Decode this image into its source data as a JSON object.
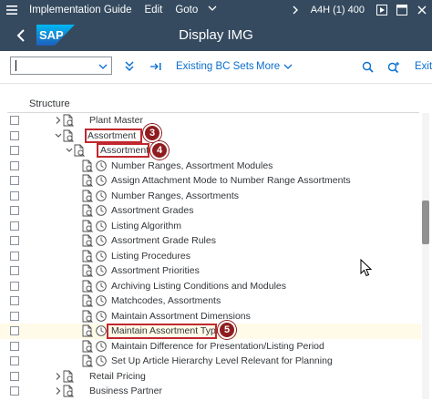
{
  "titlebar": {
    "menu": [
      "Implementation Guide",
      "Edit",
      "Goto"
    ],
    "system": "A4H (1) 400",
    "icons": [
      "hamburger-menu-icon",
      "chevron-down-icon",
      "chevron-right-icon",
      "play-icon",
      "window-icon",
      "close-icon"
    ]
  },
  "header": {
    "title": "Display IMG",
    "logo_text": "SAP",
    "brand_color": "#354a5f",
    "logo_color": "#1c8fd8"
  },
  "toolbar": {
    "command_value": "",
    "existing_bc_sets": "Existing BC Sets",
    "more": "More",
    "exit": "Exit",
    "icons": [
      "collapse-all-icon",
      "expand-subtree-icon",
      "find-icon",
      "find-next-icon"
    ]
  },
  "structure": {
    "header": "Structure",
    "rows": [
      {
        "label": "Plant Master",
        "expander": "closed"
      },
      {
        "label": "Assortment",
        "expander": "open"
      },
      {
        "label": "Assortment",
        "expander": "open"
      },
      {
        "label": "Number Ranges, Assortment Modules"
      },
      {
        "label": "Assign Attachment Mode to Number Range Assortments"
      },
      {
        "label": "Number Ranges, Assortments"
      },
      {
        "label": "Assortment Grades"
      },
      {
        "label": "Listing Algorithm"
      },
      {
        "label": "Assortment Grade Rules"
      },
      {
        "label": "Listing Procedures"
      },
      {
        "label": "Assortment Priorities"
      },
      {
        "label": "Archiving Listing Conditions and Modules"
      },
      {
        "label": "Matchcodes, Assortments"
      },
      {
        "label": "Maintain Assortment Dimensions"
      },
      {
        "label": "Maintain Assortment Types",
        "selected": true
      },
      {
        "label": "Maintain Difference for Presentation/Listing Period"
      },
      {
        "label": "Set Up Article Hierarchy Level Relevant for Planning"
      },
      {
        "label": "Retail Pricing",
        "expander": "closed"
      },
      {
        "label": "Business Partner",
        "expander": "closed"
      }
    ]
  },
  "callouts": [
    "3",
    "4",
    "5"
  ],
  "colors": {
    "callout": "#c0282d",
    "badge": "#8f1d1f",
    "link": "#0a6ed1",
    "selected_row": "#fffbe8"
  }
}
